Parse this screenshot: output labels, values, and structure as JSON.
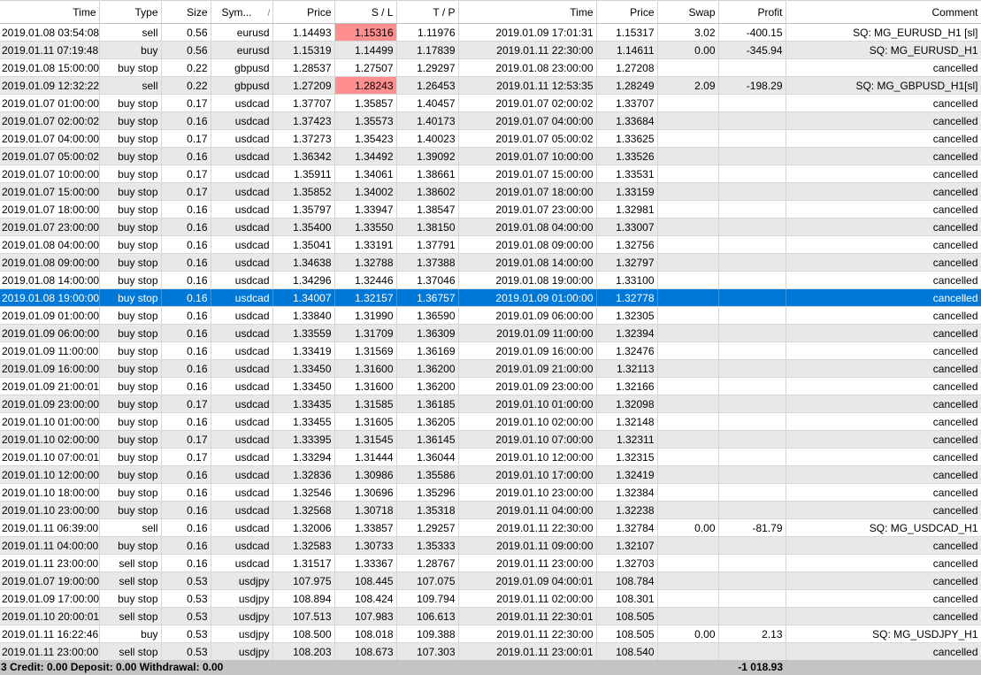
{
  "columns": [
    "Time",
    "Type",
    "Size",
    "Sym...",
    "Price",
    "S / L",
    "T / P",
    "Time",
    "Price",
    "Swap",
    "Profit",
    "Comment"
  ],
  "sort_indicator": "/",
  "highlight_color": "#ff8f8f",
  "selected_row": 15,
  "rows": [
    {
      "time": "2019.01.08 03:54:08",
      "type": "sell",
      "size": "0.56",
      "symbol": "eurusd",
      "price": "1.14493",
      "sl": "1.15316",
      "tp": "1.11976",
      "close_time": "2019.01.09 17:01:31",
      "close_price": "1.15317",
      "swap": "3.02",
      "profit": "-400.15",
      "comment": "SQ: MG_EURUSD_H1 [sl]",
      "sl_hit": true
    },
    {
      "time": "2019.01.11 07:19:48",
      "type": "buy",
      "size": "0.56",
      "symbol": "eurusd",
      "price": "1.15319",
      "sl": "1.14499",
      "tp": "1.17839",
      "close_time": "2019.01.11 22:30:00",
      "close_price": "1.14611",
      "swap": "0.00",
      "profit": "-345.94",
      "comment": "SQ: MG_EURUSD_H1"
    },
    {
      "time": "2019.01.08 15:00:00",
      "type": "buy stop",
      "size": "0.22",
      "symbol": "gbpusd",
      "price": "1.28537",
      "sl": "1.27507",
      "tp": "1.29297",
      "close_time": "2019.01.08 23:00:00",
      "close_price": "1.27208",
      "swap": "",
      "profit": "",
      "comment": "cancelled"
    },
    {
      "time": "2019.01.09 12:32:22",
      "type": "sell",
      "size": "0.22",
      "symbol": "gbpusd",
      "price": "1.27209",
      "sl": "1.28243",
      "tp": "1.26453",
      "close_time": "2019.01.11 12:53:35",
      "close_price": "1.28249",
      "swap": "2.09",
      "profit": "-198.29",
      "comment": "SQ: MG_GBPUSD_H1[sl]",
      "sl_hit": true
    },
    {
      "time": "2019.01.07 01:00:00",
      "type": "buy stop",
      "size": "0.17",
      "symbol": "usdcad",
      "price": "1.37707",
      "sl": "1.35857",
      "tp": "1.40457",
      "close_time": "2019.01.07 02:00:02",
      "close_price": "1.33707",
      "swap": "",
      "profit": "",
      "comment": "cancelled"
    },
    {
      "time": "2019.01.07 02:00:02",
      "type": "buy stop",
      "size": "0.16",
      "symbol": "usdcad",
      "price": "1.37423",
      "sl": "1.35573",
      "tp": "1.40173",
      "close_time": "2019.01.07 04:00:00",
      "close_price": "1.33684",
      "swap": "",
      "profit": "",
      "comment": "cancelled"
    },
    {
      "time": "2019.01.07 04:00:00",
      "type": "buy stop",
      "size": "0.17",
      "symbol": "usdcad",
      "price": "1.37273",
      "sl": "1.35423",
      "tp": "1.40023",
      "close_time": "2019.01.07 05:00:02",
      "close_price": "1.33625",
      "swap": "",
      "profit": "",
      "comment": "cancelled"
    },
    {
      "time": "2019.01.07 05:00:02",
      "type": "buy stop",
      "size": "0.16",
      "symbol": "usdcad",
      "price": "1.36342",
      "sl": "1.34492",
      "tp": "1.39092",
      "close_time": "2019.01.07 10:00:00",
      "close_price": "1.33526",
      "swap": "",
      "profit": "",
      "comment": "cancelled"
    },
    {
      "time": "2019.01.07 10:00:00",
      "type": "buy stop",
      "size": "0.17",
      "symbol": "usdcad",
      "price": "1.35911",
      "sl": "1.34061",
      "tp": "1.38661",
      "close_time": "2019.01.07 15:00:00",
      "close_price": "1.33531",
      "swap": "",
      "profit": "",
      "comment": "cancelled"
    },
    {
      "time": "2019.01.07 15:00:00",
      "type": "buy stop",
      "size": "0.17",
      "symbol": "usdcad",
      "price": "1.35852",
      "sl": "1.34002",
      "tp": "1.38602",
      "close_time": "2019.01.07 18:00:00",
      "close_price": "1.33159",
      "swap": "",
      "profit": "",
      "comment": "cancelled"
    },
    {
      "time": "2019.01.07 18:00:00",
      "type": "buy stop",
      "size": "0.16",
      "symbol": "usdcad",
      "price": "1.35797",
      "sl": "1.33947",
      "tp": "1.38547",
      "close_time": "2019.01.07 23:00:00",
      "close_price": "1.32981",
      "swap": "",
      "profit": "",
      "comment": "cancelled"
    },
    {
      "time": "2019.01.07 23:00:00",
      "type": "buy stop",
      "size": "0.16",
      "symbol": "usdcad",
      "price": "1.35400",
      "sl": "1.33550",
      "tp": "1.38150",
      "close_time": "2019.01.08 04:00:00",
      "close_price": "1.33007",
      "swap": "",
      "profit": "",
      "comment": "cancelled"
    },
    {
      "time": "2019.01.08 04:00:00",
      "type": "buy stop",
      "size": "0.16",
      "symbol": "usdcad",
      "price": "1.35041",
      "sl": "1.33191",
      "tp": "1.37791",
      "close_time": "2019.01.08 09:00:00",
      "close_price": "1.32756",
      "swap": "",
      "profit": "",
      "comment": "cancelled"
    },
    {
      "time": "2019.01.08 09:00:00",
      "type": "buy stop",
      "size": "0.16",
      "symbol": "usdcad",
      "price": "1.34638",
      "sl": "1.32788",
      "tp": "1.37388",
      "close_time": "2019.01.08 14:00:00",
      "close_price": "1.32797",
      "swap": "",
      "profit": "",
      "comment": "cancelled"
    },
    {
      "time": "2019.01.08 14:00:00",
      "type": "buy stop",
      "size": "0.16",
      "symbol": "usdcad",
      "price": "1.34296",
      "sl": "1.32446",
      "tp": "1.37046",
      "close_time": "2019.01.08 19:00:00",
      "close_price": "1.33100",
      "swap": "",
      "profit": "",
      "comment": "cancelled"
    },
    {
      "time": "2019.01.08 19:00:00",
      "type": "buy stop",
      "size": "0.16",
      "symbol": "usdcad",
      "price": "1.34007",
      "sl": "1.32157",
      "tp": "1.36757",
      "close_time": "2019.01.09 01:00:00",
      "close_price": "1.32778",
      "swap": "",
      "profit": "",
      "comment": "cancelled"
    },
    {
      "time": "2019.01.09 01:00:00",
      "type": "buy stop",
      "size": "0.16",
      "symbol": "usdcad",
      "price": "1.33840",
      "sl": "1.31990",
      "tp": "1.36590",
      "close_time": "2019.01.09 06:00:00",
      "close_price": "1.32305",
      "swap": "",
      "profit": "",
      "comment": "cancelled"
    },
    {
      "time": "2019.01.09 06:00:00",
      "type": "buy stop",
      "size": "0.16",
      "symbol": "usdcad",
      "price": "1.33559",
      "sl": "1.31709",
      "tp": "1.36309",
      "close_time": "2019.01.09 11:00:00",
      "close_price": "1.32394",
      "swap": "",
      "profit": "",
      "comment": "cancelled"
    },
    {
      "time": "2019.01.09 11:00:00",
      "type": "buy stop",
      "size": "0.16",
      "symbol": "usdcad",
      "price": "1.33419",
      "sl": "1.31569",
      "tp": "1.36169",
      "close_time": "2019.01.09 16:00:00",
      "close_price": "1.32476",
      "swap": "",
      "profit": "",
      "comment": "cancelled"
    },
    {
      "time": "2019.01.09 16:00:00",
      "type": "buy stop",
      "size": "0.16",
      "symbol": "usdcad",
      "price": "1.33450",
      "sl": "1.31600",
      "tp": "1.36200",
      "close_time": "2019.01.09 21:00:00",
      "close_price": "1.32113",
      "swap": "",
      "profit": "",
      "comment": "cancelled"
    },
    {
      "time": "2019.01.09 21:00:01",
      "type": "buy stop",
      "size": "0.16",
      "symbol": "usdcad",
      "price": "1.33450",
      "sl": "1.31600",
      "tp": "1.36200",
      "close_time": "2019.01.09 23:00:00",
      "close_price": "1.32166",
      "swap": "",
      "profit": "",
      "comment": "cancelled"
    },
    {
      "time": "2019.01.09 23:00:00",
      "type": "buy stop",
      "size": "0.17",
      "symbol": "usdcad",
      "price": "1.33435",
      "sl": "1.31585",
      "tp": "1.36185",
      "close_time": "2019.01.10 01:00:00",
      "close_price": "1.32098",
      "swap": "",
      "profit": "",
      "comment": "cancelled"
    },
    {
      "time": "2019.01.10 01:00:00",
      "type": "buy stop",
      "size": "0.16",
      "symbol": "usdcad",
      "price": "1.33455",
      "sl": "1.31605",
      "tp": "1.36205",
      "close_time": "2019.01.10 02:00:00",
      "close_price": "1.32148",
      "swap": "",
      "profit": "",
      "comment": "cancelled"
    },
    {
      "time": "2019.01.10 02:00:00",
      "type": "buy stop",
      "size": "0.17",
      "symbol": "usdcad",
      "price": "1.33395",
      "sl": "1.31545",
      "tp": "1.36145",
      "close_time": "2019.01.10 07:00:00",
      "close_price": "1.32311",
      "swap": "",
      "profit": "",
      "comment": "cancelled"
    },
    {
      "time": "2019.01.10 07:00:01",
      "type": "buy stop",
      "size": "0.17",
      "symbol": "usdcad",
      "price": "1.33294",
      "sl": "1.31444",
      "tp": "1.36044",
      "close_time": "2019.01.10 12:00:00",
      "close_price": "1.32315",
      "swap": "",
      "profit": "",
      "comment": "cancelled"
    },
    {
      "time": "2019.01.10 12:00:00",
      "type": "buy stop",
      "size": "0.16",
      "symbol": "usdcad",
      "price": "1.32836",
      "sl": "1.30986",
      "tp": "1.35586",
      "close_time": "2019.01.10 17:00:00",
      "close_price": "1.32419",
      "swap": "",
      "profit": "",
      "comment": "cancelled"
    },
    {
      "time": "2019.01.10 18:00:00",
      "type": "buy stop",
      "size": "0.16",
      "symbol": "usdcad",
      "price": "1.32546",
      "sl": "1.30696",
      "tp": "1.35296",
      "close_time": "2019.01.10 23:00:00",
      "close_price": "1.32384",
      "swap": "",
      "profit": "",
      "comment": "cancelled"
    },
    {
      "time": "2019.01.10 23:00:00",
      "type": "buy stop",
      "size": "0.16",
      "symbol": "usdcad",
      "price": "1.32568",
      "sl": "1.30718",
      "tp": "1.35318",
      "close_time": "2019.01.11 04:00:00",
      "close_price": "1.32238",
      "swap": "",
      "profit": "",
      "comment": "cancelled"
    },
    {
      "time": "2019.01.11 06:39:00",
      "type": "sell",
      "size": "0.16",
      "symbol": "usdcad",
      "price": "1.32006",
      "sl": "1.33857",
      "tp": "1.29257",
      "close_time": "2019.01.11 22:30:00",
      "close_price": "1.32784",
      "swap": "0.00",
      "profit": "-81.79",
      "comment": "SQ: MG_USDCAD_H1"
    },
    {
      "time": "2019.01.11 04:00:00",
      "type": "buy stop",
      "size": "0.16",
      "symbol": "usdcad",
      "price": "1.32583",
      "sl": "1.30733",
      "tp": "1.35333",
      "close_time": "2019.01.11 09:00:00",
      "close_price": "1.32107",
      "swap": "",
      "profit": "",
      "comment": "cancelled"
    },
    {
      "time": "2019.01.11 23:00:00",
      "type": "sell stop",
      "size": "0.16",
      "symbol": "usdcad",
      "price": "1.31517",
      "sl": "1.33367",
      "tp": "1.28767",
      "close_time": "2019.01.11 23:00:00",
      "close_price": "1.32703",
      "swap": "",
      "profit": "",
      "comment": "cancelled"
    },
    {
      "time": "2019.01.07 19:00:00",
      "type": "sell stop",
      "size": "0.53",
      "symbol": "usdjpy",
      "price": "107.975",
      "sl": "108.445",
      "tp": "107.075",
      "close_time": "2019.01.09 04:00:01",
      "close_price": "108.784",
      "swap": "",
      "profit": "",
      "comment": "cancelled"
    },
    {
      "time": "2019.01.09 17:00:00",
      "type": "buy stop",
      "size": "0.53",
      "symbol": "usdjpy",
      "price": "108.894",
      "sl": "108.424",
      "tp": "109.794",
      "close_time": "2019.01.11 02:00:00",
      "close_price": "108.301",
      "swap": "",
      "profit": "",
      "comment": "cancelled"
    },
    {
      "time": "2019.01.10 20:00:01",
      "type": "sell stop",
      "size": "0.53",
      "symbol": "usdjpy",
      "price": "107.513",
      "sl": "107.983",
      "tp": "106.613",
      "close_time": "2019.01.11 22:30:01",
      "close_price": "108.505",
      "swap": "",
      "profit": "",
      "comment": "cancelled"
    },
    {
      "time": "2019.01.11 16:22:46",
      "type": "buy",
      "size": "0.53",
      "symbol": "usdjpy",
      "price": "108.500",
      "sl": "108.018",
      "tp": "109.388",
      "close_time": "2019.01.11 22:30:00",
      "close_price": "108.505",
      "swap": "0.00",
      "profit": "2.13",
      "comment": "SQ: MG_USDJPY_H1"
    },
    {
      "time": "2019.01.11 23:00:00",
      "type": "sell stop",
      "size": "0.53",
      "symbol": "usdjpy",
      "price": "108.203",
      "sl": "108.673",
      "tp": "107.303",
      "close_time": "2019.01.11 23:00:01",
      "close_price": "108.540",
      "swap": "",
      "profit": "",
      "comment": "cancelled"
    }
  ],
  "footer": {
    "summary": "3  Credit: 0.00  Deposit: 0.00  Withdrawal: 0.00",
    "total_profit": "-1 018.93"
  }
}
